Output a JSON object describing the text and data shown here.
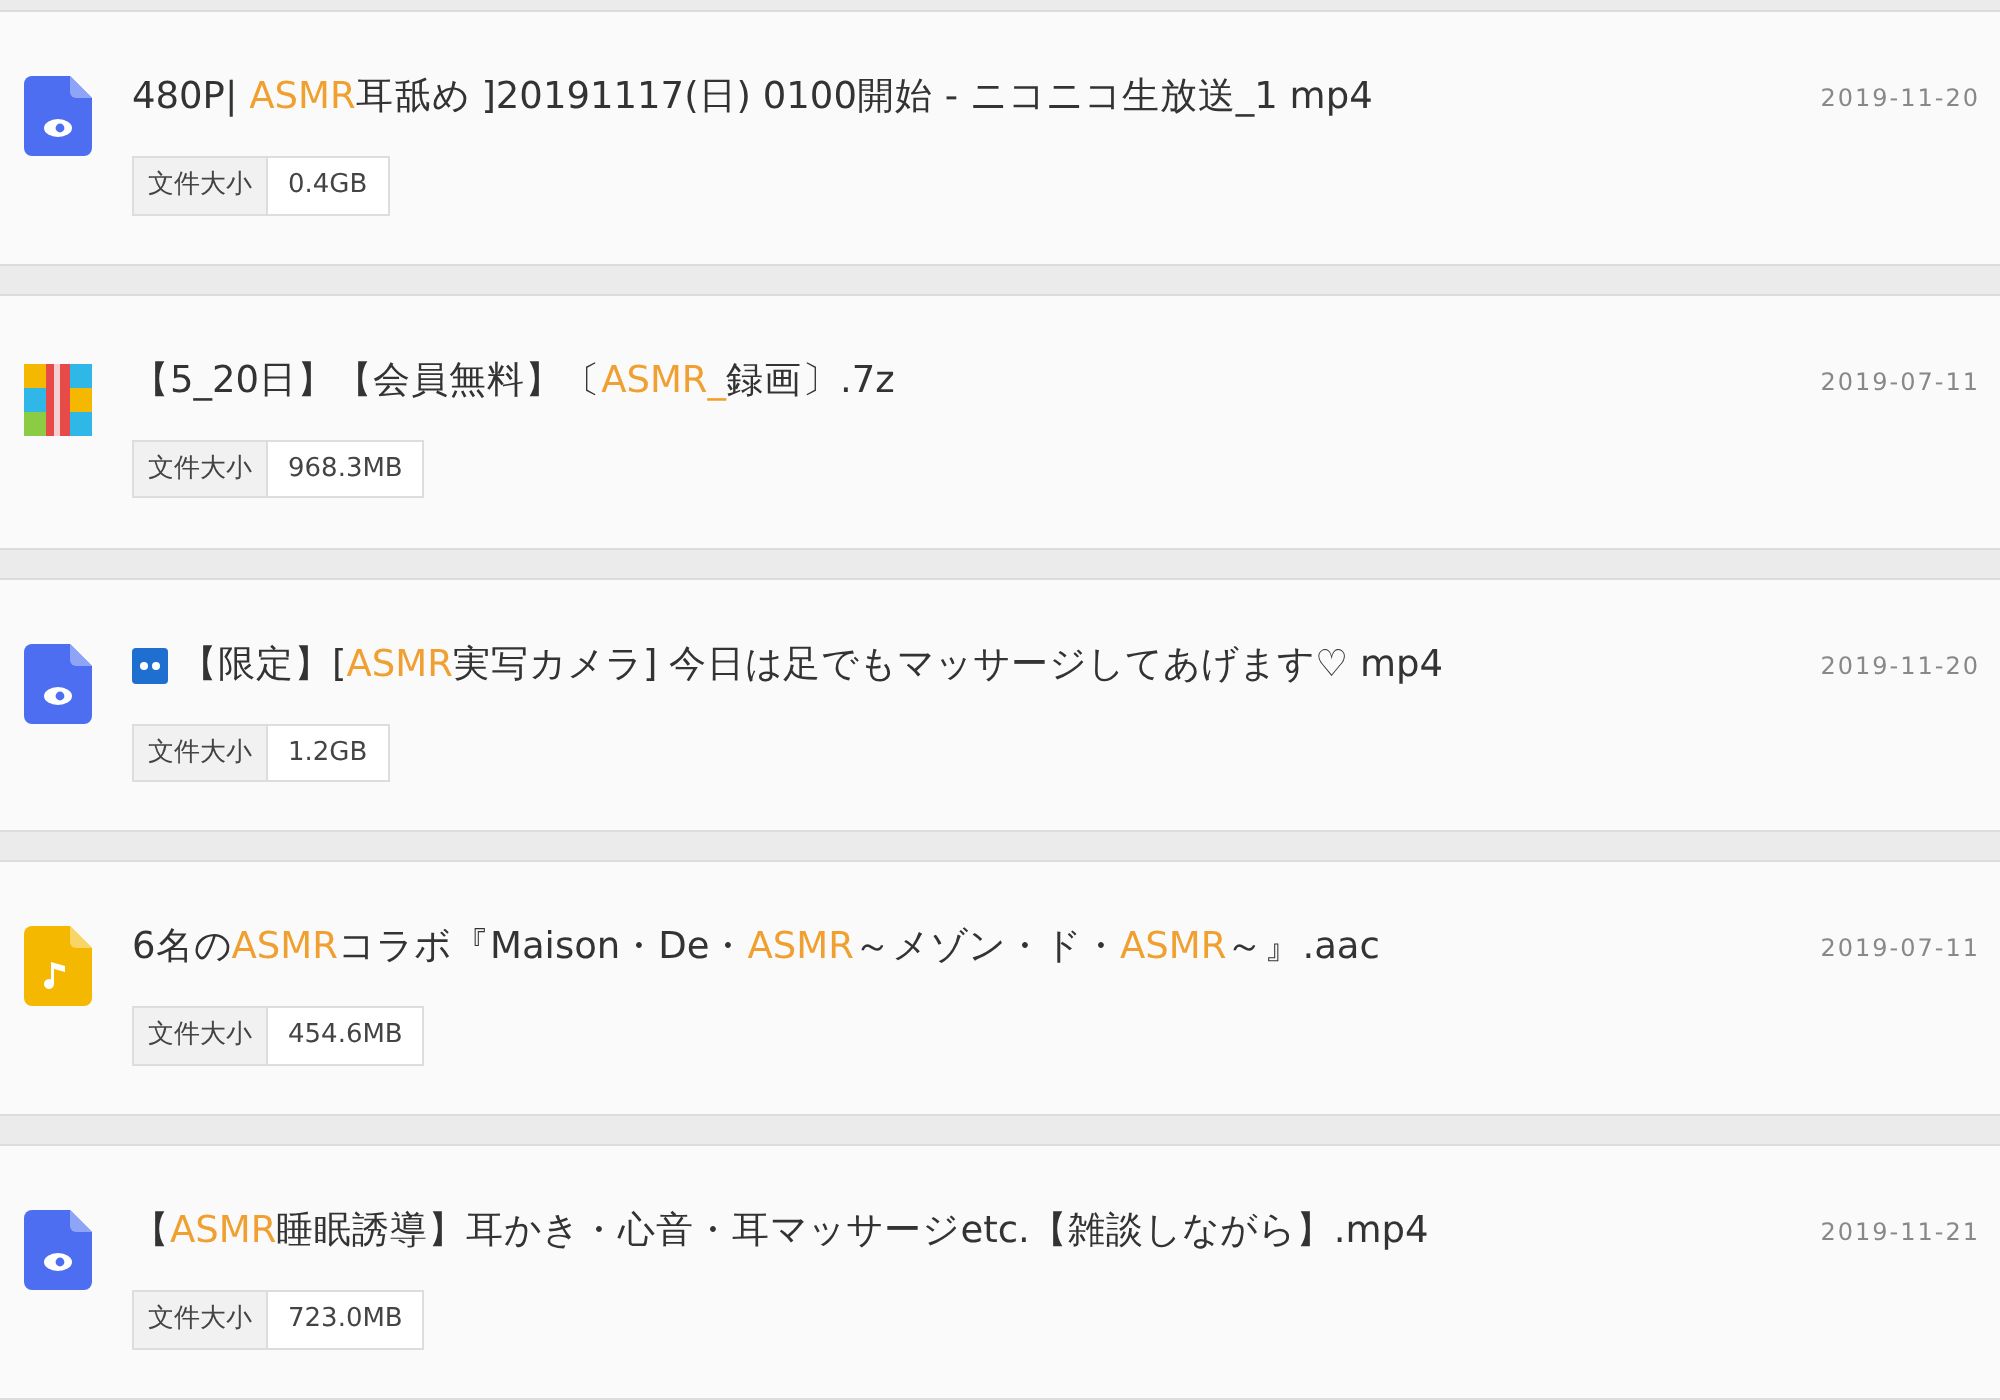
{
  "files": [
    {
      "kind": "video",
      "title": [
        {
          "text": "480P| "
        },
        {
          "text": "ASMR",
          "highlight": true
        },
        {
          "text": "耳舐め ]20191117(日) 0100開始 - ニコニコ生放送_1 mp4"
        }
      ],
      "date": "2019-11-20",
      "size_label": "文件大小",
      "size": "0.4GB"
    },
    {
      "kind": "archive",
      "title": [
        {
          "text": "【5_20日】【会員無料】〔"
        },
        {
          "text": "ASMR_",
          "highlight": true
        },
        {
          "text": "録画〕.7z"
        }
      ],
      "date": "2019-07-11",
      "size_label": "文件大小",
      "size": "968.3MB"
    },
    {
      "kind": "video",
      "prefix_icon": true,
      "title": [
        {
          "text": "【限定】["
        },
        {
          "text": "ASMR",
          "highlight": true
        },
        {
          "text": "実写カメラ] 今日は足でもマッサージしてあげます♡ mp4"
        }
      ],
      "date": "2019-11-20",
      "size_label": "文件大小",
      "size": "1.2GB"
    },
    {
      "kind": "audio",
      "title": [
        {
          "text": "6名の"
        },
        {
          "text": "ASMR",
          "highlight": true
        },
        {
          "text": "コラボ『Maison・De・"
        },
        {
          "text": "ASMR",
          "highlight": true
        },
        {
          "text": "～メゾン・ド・"
        },
        {
          "text": "ASMR",
          "highlight": true
        },
        {
          "text": "～』.aac"
        }
      ],
      "date": "2019-07-11",
      "size_label": "文件大小",
      "size": "454.6MB"
    },
    {
      "kind": "video",
      "title": [
        {
          "text": "【"
        },
        {
          "text": "ASMR",
          "highlight": true
        },
        {
          "text": "睡眠誘導】耳かき・心音・耳マッサージetc.【雑談しながら】.mp4"
        }
      ],
      "date": "2019-11-21",
      "size_label": "文件大小",
      "size": "723.0MB"
    }
  ]
}
